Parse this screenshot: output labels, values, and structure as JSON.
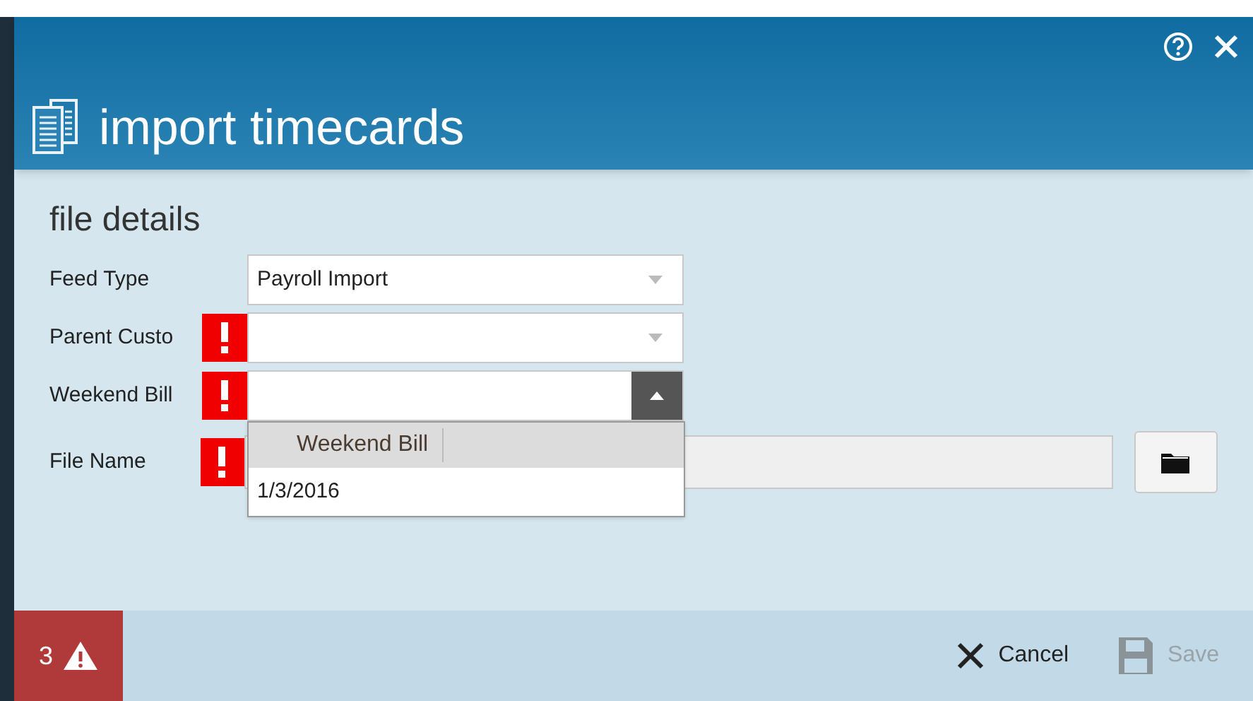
{
  "dialog": {
    "title": "import timecards"
  },
  "section_title": "file details",
  "fields": [
    {
      "kind": "dropdown",
      "label": "Feed Type",
      "value": "Payroll Import",
      "error": false,
      "open": false
    },
    {
      "kind": "dropdown",
      "label": "Parent Custo",
      "error": true,
      "open": false
    },
    {
      "kind": "dropdown",
      "label": "Weekend Bill",
      "error": true,
      "open": true,
      "list": {
        "header": "Weekend Bill",
        "options": [
          "1/3/2016"
        ]
      }
    },
    {
      "kind": "file",
      "label": "File Name",
      "error": true
    }
  ],
  "footer": {
    "error_count": "3",
    "buttons": [
      {
        "kind": "cancel",
        "label": "Cancel",
        "disabled": false
      },
      {
        "kind": "save",
        "label": "Save",
        "disabled": true
      }
    ]
  }
}
